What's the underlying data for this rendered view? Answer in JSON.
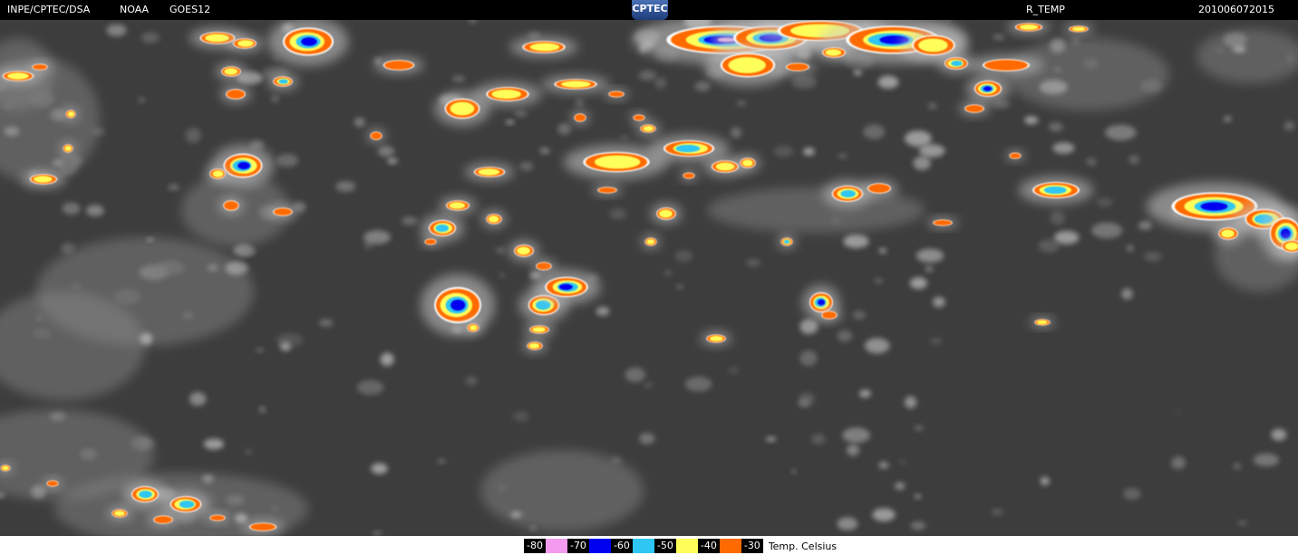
{
  "header": {
    "source": "INPE/CPTEC/DSA",
    "agency": "NOAA",
    "satellite": "GOES12",
    "logo_text": "CPTEC",
    "product": "R_TEMP",
    "timestamp": "201006072015"
  },
  "legend": {
    "items": [
      {
        "label": "-80",
        "color": "#f49bef"
      },
      {
        "label": "-70",
        "color": "#0000f0"
      },
      {
        "label": "-60",
        "color": "#2ec6f2"
      },
      {
        "label": "-50",
        "color": "#ffff5a"
      },
      {
        "label": "-40",
        "color": "#ff6a00"
      },
      {
        "label": "-30",
        "color": ""
      }
    ],
    "unit": "Temp. Celsius"
  },
  "colors": {
    "background": "#3d3d3d",
    "cloud_light": "#bdbdbd",
    "cloud_mid": "#8a8a8a"
  }
}
